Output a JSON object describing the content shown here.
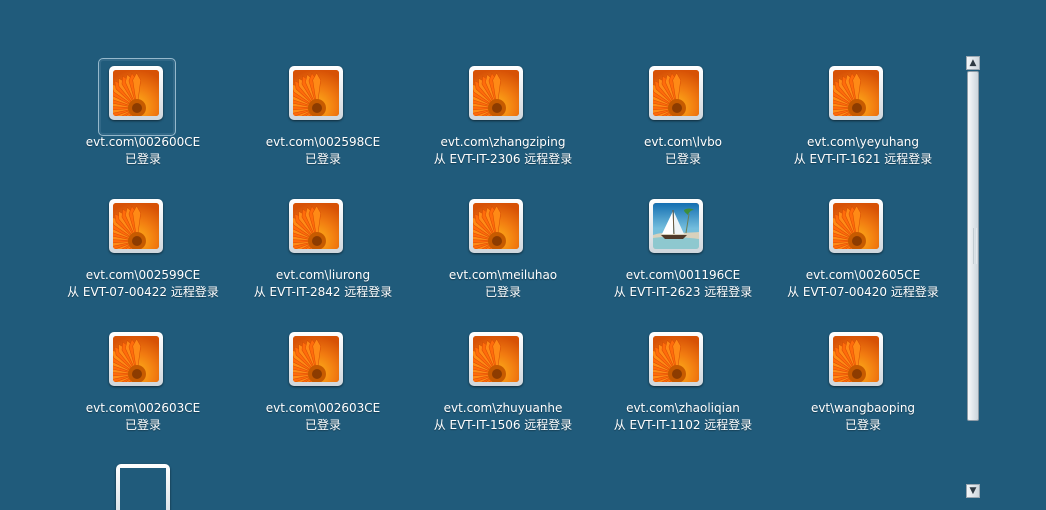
{
  "accent": "#205b7b",
  "icons": {
    "avatar_flower": "orange-flower-avatar-icon",
    "avatar_boat": "sailboat-avatar-icon",
    "scroll_up": "scroll-up-arrow-icon",
    "scroll_down": "scroll-down-arrow-icon"
  },
  "users": [
    {
      "name": "evt.com\\002600CE",
      "status": "已登录",
      "avatar": "flower"
    },
    {
      "name": "evt.com\\002598CE",
      "status": "已登录",
      "avatar": "flower"
    },
    {
      "name": "evt.com\\zhangziping",
      "status": "从 EVT-IT-2306 远程登录",
      "avatar": "flower"
    },
    {
      "name": "evt.com\\lvbo",
      "status": "已登录",
      "avatar": "flower"
    },
    {
      "name": "evt.com\\yeyuhang",
      "status": "从 EVT-IT-1621 远程登录",
      "avatar": "flower"
    },
    {
      "name": "evt.com\\002599CE",
      "status": "从 EVT-07-00422 远程登录",
      "avatar": "flower"
    },
    {
      "name": "evt.com\\liurong",
      "status": "从 EVT-IT-2842 远程登录",
      "avatar": "flower"
    },
    {
      "name": "evt.com\\meiluhao",
      "status": "已登录",
      "avatar": "flower"
    },
    {
      "name": "evt.com\\001196CE",
      "status": "从 EVT-IT-2623 远程登录",
      "avatar": "boat"
    },
    {
      "name": "evt.com\\002605CE",
      "status": "从 EVT-07-00420 远程登录",
      "avatar": "flower"
    },
    {
      "name": "evt.com\\002603CE",
      "status": "已登录",
      "avatar": "flower"
    },
    {
      "name": "evt.com\\002603CE",
      "status": "已登录",
      "avatar": "flower"
    },
    {
      "name": "evt.com\\zhuyuanhe",
      "status": "从 EVT-IT-1506 远程登录",
      "avatar": "flower"
    },
    {
      "name": "evt.com\\zhaoliqian",
      "status": "从 EVT-IT-1102 远程登录",
      "avatar": "flower"
    },
    {
      "name": "evt\\wangbaoping",
      "status": "已登录",
      "avatar": "flower"
    }
  ],
  "scrollbar": {
    "up_glyph": "▲",
    "down_glyph": "▼"
  }
}
